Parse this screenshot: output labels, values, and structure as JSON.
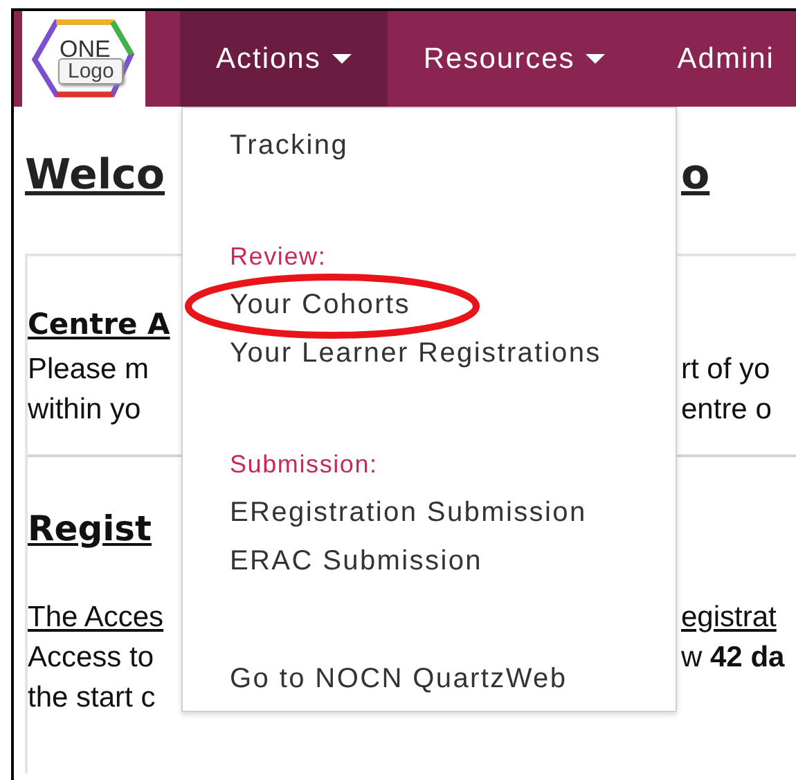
{
  "logo": {
    "text": "ONE",
    "label": "Logo"
  },
  "nav": [
    {
      "label": "Actions",
      "caret": true,
      "selected": true
    },
    {
      "label": "Resources",
      "caret": true,
      "selected": false
    },
    {
      "label": "Admini",
      "caret": false,
      "selected": false
    }
  ],
  "dropdown": {
    "groups": [
      {
        "items": [
          {
            "label": "Tracking",
            "circled": false
          }
        ]
      },
      {
        "header": "Review:",
        "items": [
          {
            "label": "Your Cohorts",
            "circled": true
          },
          {
            "label": "Your Learner Registrations",
            "circled": false
          }
        ]
      },
      {
        "header": "Submission:",
        "items": [
          {
            "label": "ERegistration Submission",
            "circled": false
          },
          {
            "label": "ERAC Submission",
            "circled": false
          }
        ]
      },
      {
        "items": [
          {
            "label": "Go to NOCN QuartzWeb",
            "circled": false
          }
        ]
      }
    ]
  },
  "content": {
    "title": {
      "left": "Welco",
      "right": "o"
    },
    "lines": [
      {
        "kind": "heading",
        "left": "Centre A"
      },
      {
        "kind": "text",
        "left": "Please m",
        "right": "rt of yo"
      },
      {
        "kind": "text",
        "left": "within yo",
        "right": "entre o"
      },
      {
        "kind": "rule"
      },
      {
        "kind": "heading2",
        "left": "Regist"
      },
      {
        "kind": "link",
        "left": "The Acces",
        "right": "egistrat"
      },
      {
        "kind": "text",
        "left": "Access to",
        "right": "w **42 da**"
      },
      {
        "kind": "text",
        "left": "the start c"
      }
    ]
  }
}
